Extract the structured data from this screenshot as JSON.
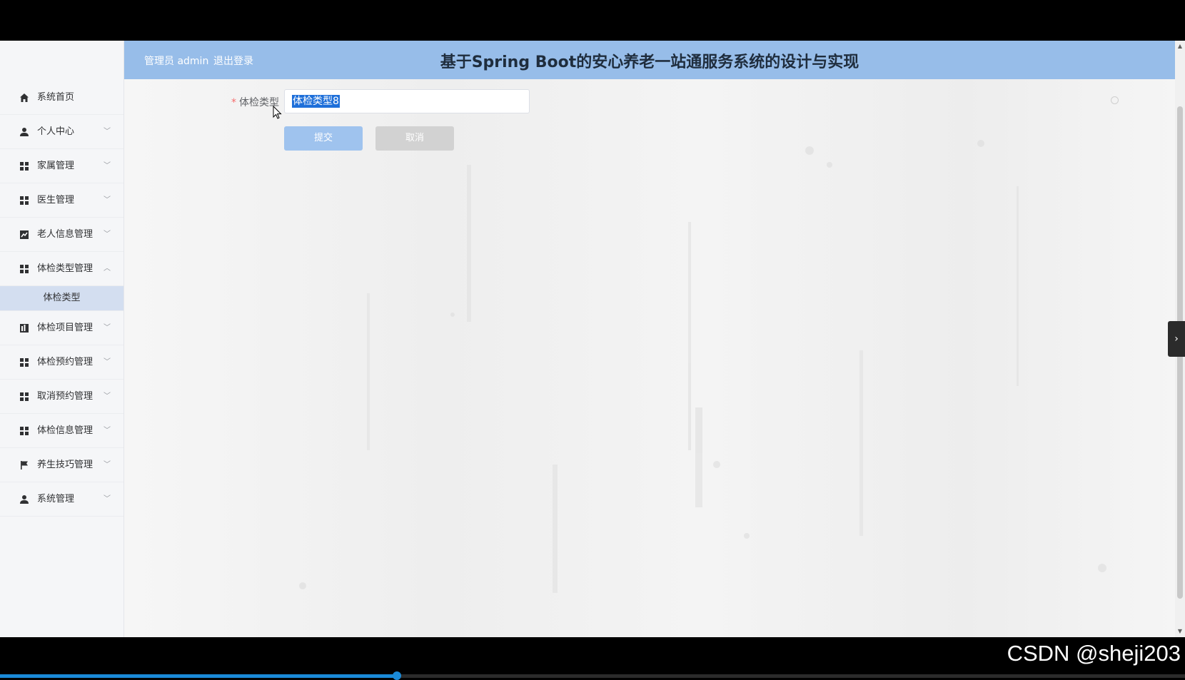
{
  "header": {
    "user_text": "管理员 admin",
    "logout_label": "退出登录",
    "title": "基于Spring Boot的安心养老一站通服务系统的设计与实现"
  },
  "sidebar": {
    "items": [
      {
        "label": "系统首页",
        "icon": "home-icon",
        "has_chevron": false
      },
      {
        "label": "个人中心",
        "icon": "user-icon",
        "has_chevron": true
      },
      {
        "label": "家属管理",
        "icon": "grid-icon",
        "has_chevron": true
      },
      {
        "label": "医生管理",
        "icon": "grid-icon",
        "has_chevron": true
      },
      {
        "label": "老人信息管理",
        "icon": "chart-icon",
        "has_chevron": true
      },
      {
        "label": "体检类型管理",
        "icon": "grid-icon",
        "has_chevron": true,
        "expanded": true
      },
      {
        "label": "体检项目管理",
        "icon": "bar-chart-icon",
        "has_chevron": true
      },
      {
        "label": "体检预约管理",
        "icon": "grid-icon",
        "has_chevron": true
      },
      {
        "label": "取消预约管理",
        "icon": "grid-icon",
        "has_chevron": true
      },
      {
        "label": "体检信息管理",
        "icon": "grid-icon",
        "has_chevron": true
      },
      {
        "label": "养生技巧管理",
        "icon": "flag-icon",
        "has_chevron": true
      },
      {
        "label": "系统管理",
        "icon": "user-icon",
        "has_chevron": true
      }
    ],
    "active_submenu": "体检类型",
    "chevron_down": "﹀",
    "chevron_up": "︿"
  },
  "form": {
    "required_mark": "*",
    "field_label": "体检类型",
    "field_value": "体检类型8",
    "submit_label": "提交",
    "cancel_label": "取消"
  },
  "overlay": {
    "side_handle": "›",
    "video_progress": 0.335
  },
  "watermark": "CSDN @sheji203",
  "colors": {
    "header_bg": "#97bde9",
    "submit_bg": "#9fc3ee",
    "cancel_bg": "#d2d2d2",
    "active_submenu_bg": "#d3def0",
    "required": "#f56c6c"
  }
}
